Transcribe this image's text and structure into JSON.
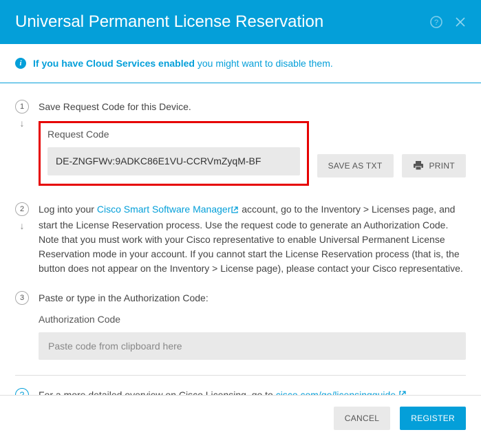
{
  "header": {
    "title": "Universal Permanent License Reservation"
  },
  "info": {
    "bold": "If you have Cloud Services enabled",
    "rest": " you might want to disable them."
  },
  "steps": {
    "s1": {
      "num": "1",
      "title": "Save Request Code for this Device.",
      "label": "Request Code",
      "code": "DE-ZNGFWv:9ADKC86E1VU-CCRVmZyqM-BF",
      "saveTxt": "SAVE AS TXT",
      "print": "PRINT"
    },
    "s2": {
      "num": "2",
      "pre": "Log into your ",
      "link": "Cisco Smart Software Manager",
      "post": " account, go to the Inventory > Licenses page, and start the License Reservation process. Use the request code to generate an Authorization Code. Note that you must work with your Cisco representative to enable Universal Permanent License Reservation mode in your account. If you cannot start the License Reservation process (that is, the button does not appear on the Inventory > License page), please contact your Cisco representative."
    },
    "s3": {
      "num": "3",
      "title": "Paste or type in the Authorization Code:",
      "label": "Authorization Code",
      "placeholder": "Paste code from clipboard here"
    }
  },
  "help": {
    "text": "For a more detailed overview on Cisco Licensing, go to ",
    "link": "cisco.com/go/licensingguide"
  },
  "footer": {
    "cancel": "CANCEL",
    "register": "REGISTER"
  }
}
